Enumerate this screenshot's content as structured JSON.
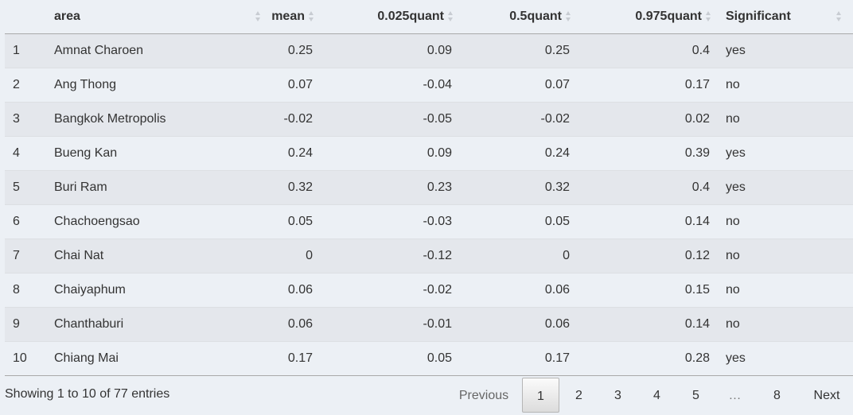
{
  "columns": [
    "",
    "area",
    "mean",
    "0.025quant",
    "0.5quant",
    "0.975quant",
    "Significant"
  ],
  "rows": [
    {
      "idx": "1",
      "area": "Amnat Charoen",
      "mean": "0.25",
      "q025": "0.09",
      "q5": "0.25",
      "q975": "0.4",
      "sig": "yes"
    },
    {
      "idx": "2",
      "area": "Ang Thong",
      "mean": "0.07",
      "q025": "-0.04",
      "q5": "0.07",
      "q975": "0.17",
      "sig": "no"
    },
    {
      "idx": "3",
      "area": "Bangkok Metropolis",
      "mean": "-0.02",
      "q025": "-0.05",
      "q5": "-0.02",
      "q975": "0.02",
      "sig": "no"
    },
    {
      "idx": "4",
      "area": "Bueng Kan",
      "mean": "0.24",
      "q025": "0.09",
      "q5": "0.24",
      "q975": "0.39",
      "sig": "yes"
    },
    {
      "idx": "5",
      "area": "Buri Ram",
      "mean": "0.32",
      "q025": "0.23",
      "q5": "0.32",
      "q975": "0.4",
      "sig": "yes"
    },
    {
      "idx": "6",
      "area": "Chachoengsao",
      "mean": "0.05",
      "q025": "-0.03",
      "q5": "0.05",
      "q975": "0.14",
      "sig": "no"
    },
    {
      "idx": "7",
      "area": "Chai Nat",
      "mean": "0",
      "q025": "-0.12",
      "q5": "0",
      "q975": "0.12",
      "sig": "no"
    },
    {
      "idx": "8",
      "area": "Chaiyaphum",
      "mean": "0.06",
      "q025": "-0.02",
      "q5": "0.06",
      "q975": "0.15",
      "sig": "no"
    },
    {
      "idx": "9",
      "area": "Chanthaburi",
      "mean": "0.06",
      "q025": "-0.01",
      "q5": "0.06",
      "q975": "0.14",
      "sig": "no"
    },
    {
      "idx": "10",
      "area": "Chiang Mai",
      "mean": "0.17",
      "q025": "0.05",
      "q5": "0.17",
      "q975": "0.28",
      "sig": "yes"
    }
  ],
  "info": "Showing 1 to 10 of 77 entries",
  "pagination": {
    "previous": "Previous",
    "pages": [
      "1",
      "2",
      "3",
      "4",
      "5",
      "…",
      "8"
    ],
    "next": "Next",
    "current": "1"
  }
}
